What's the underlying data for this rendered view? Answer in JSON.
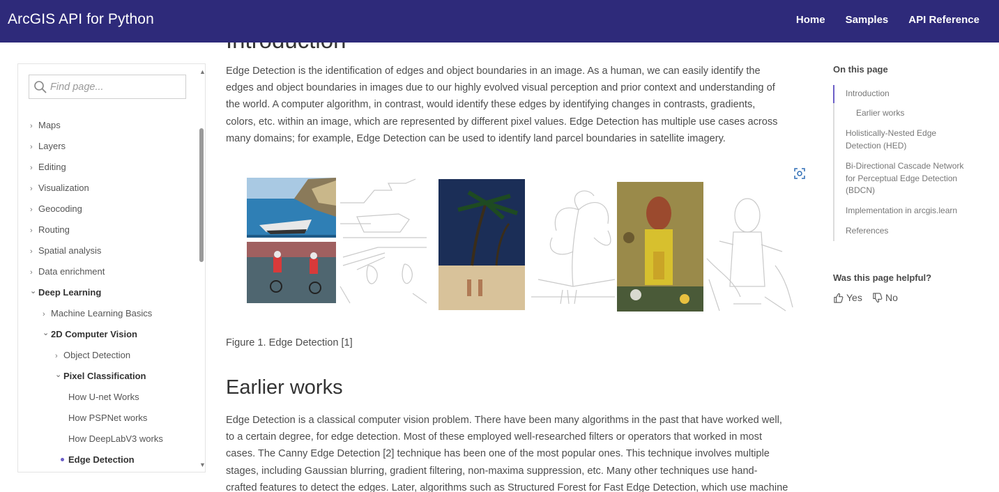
{
  "header": {
    "brand": "ArcGIS API for Python",
    "nav": [
      "Home",
      "Samples",
      "API Reference"
    ]
  },
  "sidebar": {
    "search_placeholder": "Find page...",
    "items": [
      {
        "label": "Maps",
        "level": 0,
        "state": "collapsed"
      },
      {
        "label": "Layers",
        "level": 0,
        "state": "collapsed"
      },
      {
        "label": "Editing",
        "level": 0,
        "state": "collapsed"
      },
      {
        "label": "Visualization",
        "level": 0,
        "state": "collapsed"
      },
      {
        "label": "Geocoding",
        "level": 0,
        "state": "collapsed"
      },
      {
        "label": "Routing",
        "level": 0,
        "state": "collapsed"
      },
      {
        "label": "Spatial analysis",
        "level": 0,
        "state": "collapsed"
      },
      {
        "label": "Data enrichment",
        "level": 0,
        "state": "collapsed"
      },
      {
        "label": "Deep Learning",
        "level": 0,
        "state": "expanded"
      },
      {
        "label": "Machine Learning Basics",
        "level": 1,
        "state": "collapsed"
      },
      {
        "label": "2D Computer Vision",
        "level": 1,
        "state": "expanded"
      },
      {
        "label": "Object Detection",
        "level": 2,
        "state": "collapsed"
      },
      {
        "label": "Pixel Classification",
        "level": 2,
        "state": "expanded"
      },
      {
        "label": "How U-net Works",
        "level": 3,
        "state": "leaf"
      },
      {
        "label": "How PSPNet works",
        "level": 3,
        "state": "leaf"
      },
      {
        "label": "How DeepLabV3 works",
        "level": 3,
        "state": "leaf"
      },
      {
        "label": "Edge Detection",
        "level": 3,
        "state": "current"
      }
    ]
  },
  "content": {
    "heading_intro": "Introduction",
    "intro_lines": [
      "Edge Detection is the identification of edges and object boundaries in an image. As a human, we can easily identify the",
      "edges and object boundaries in images due to our highly evolved visual perception and prior context and understanding of",
      "the world. A computer algorithm, in contrast, would identify these edges by identifying changes in contrasts, gradients,",
      "colors, etc. within an image, which are represented by different pixel values. Edge Detection has multiple use cases across",
      "many domains; for example, Edge Detection can be used to identify land parcel boundaries in satellite imagery."
    ],
    "figure_caption": "Figure 1. Edge Detection [1]",
    "heading_earlier": "Earlier works",
    "earlier_lines": [
      "Edge Detection is a classical computer vision problem. There have been many algorithms in the past that have worked well,",
      "to a certain degree, for edge detection. Most of these employed well-researched filters or operators that worked in most",
      "cases. The Canny Edge Detection [2] technique has been one of the most popular ones. This technique involves multiple",
      "stages, including Gaussian blurring, gradient filtering, non-maxima suppression, etc. Many other techniques use hand-",
      "crafted features to detect the edges. Later, algorithms such as Structured Forest for Fast Edge Detection, which use machine"
    ]
  },
  "toc": {
    "title": "On this page",
    "items": [
      "Introduction",
      "Earlier works",
      "Holistically-Nested Edge Detection (HED)",
      "Bi-Directional Cascade Network for Perceptual Edge Detection (BDCN)",
      "Implementation in arcgis.learn",
      "References"
    ]
  },
  "feedback": {
    "question": "Was this page helpful?",
    "yes": "Yes",
    "no": "No"
  },
  "colors": {
    "header_bg": "#2e2a7a",
    "accent": "#6c5fc7"
  }
}
